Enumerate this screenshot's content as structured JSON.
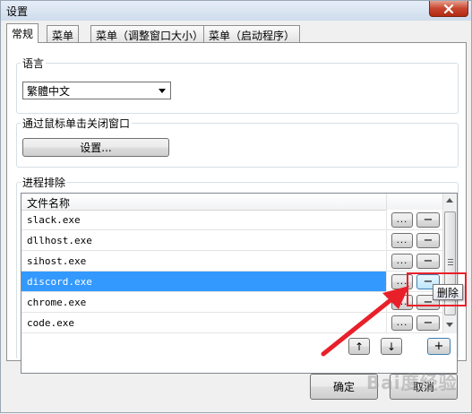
{
  "window": {
    "title": "设置"
  },
  "tabs": [
    {
      "label": "常规",
      "active": true
    },
    {
      "label": "菜单",
      "active": false
    },
    {
      "label": "菜单（调整窗口大小）",
      "active": false
    },
    {
      "label": "菜单（启动程序）",
      "active": false
    }
  ],
  "language_group": {
    "label": "语言",
    "selected_value": "繁體中文"
  },
  "mouse_close_group": {
    "label": "通过鼠标单击关闭窗口",
    "settings_button": "设置..."
  },
  "process_exclusion_group": {
    "label": "进程排除",
    "column_header": "文件名称",
    "rows": [
      {
        "name": "slack.exe",
        "selected": false
      },
      {
        "name": "dllhost.exe",
        "selected": false
      },
      {
        "name": "sihost.exe",
        "selected": false
      },
      {
        "name": "discord.exe",
        "selected": true
      },
      {
        "name": "chrome.exe",
        "selected": false
      },
      {
        "name": "code.exe",
        "selected": false
      }
    ],
    "row_browse_label": "...",
    "row_remove_label": "−",
    "move_up_label": "↑",
    "move_down_label": "↓",
    "add_label": "+",
    "tooltip": "删除"
  },
  "footer": {
    "ok_label": "确定",
    "cancel_label": "取消"
  },
  "colors": {
    "selection": "#3399ff",
    "annotation": "#e8202a"
  },
  "watermark_text": "Bai度经验"
}
